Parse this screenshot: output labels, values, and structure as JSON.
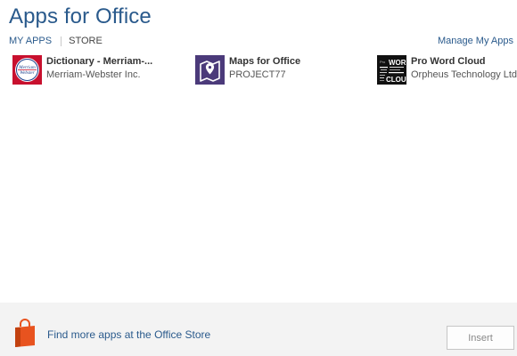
{
  "header": {
    "title": "Apps for Office",
    "tabs": [
      {
        "label": "MY APPS",
        "active": true
      },
      {
        "label": "STORE",
        "active": false
      }
    ],
    "manage_link": "Manage My Apps"
  },
  "apps": [
    {
      "name": "Dictionary - Merriam-...",
      "publisher": "Merriam-Webster Inc.",
      "icon": "merriam-webster-logo",
      "icon_text": "Merriam-Webster"
    },
    {
      "name": "Maps for Office",
      "publisher": "PROJECT77",
      "icon": "map-pin-icon"
    },
    {
      "name": "Pro Word Cloud",
      "publisher": "Orpheus Technology Ltd.",
      "icon": "word-cloud-icon"
    }
  ],
  "footer": {
    "store_link": "Find more apps at the Office Store",
    "insert_label": "Insert",
    "store_icon": "shopping-bag-icon"
  },
  "colors": {
    "accent": "#2a5a8c",
    "store_orange": "#e8531f",
    "maps_purple": "#4b3a7a",
    "dictionary_red": "#c8102e"
  }
}
